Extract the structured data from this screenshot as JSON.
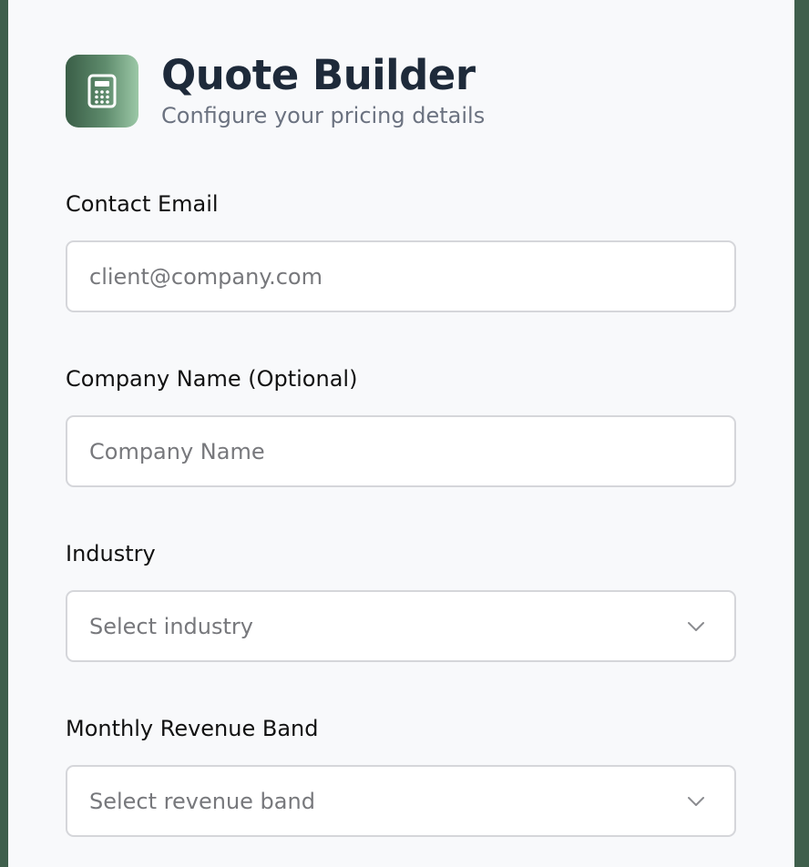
{
  "header": {
    "title": "Quote Builder",
    "subtitle": "Configure your pricing details",
    "logo_icon": "calculator-icon"
  },
  "form": {
    "contact_email": {
      "label": "Contact Email",
      "placeholder": "client@company.com",
      "value": ""
    },
    "company_name": {
      "label": "Company Name (Optional)",
      "placeholder": "Company Name",
      "value": ""
    },
    "industry": {
      "label": "Industry",
      "selected": "Select industry",
      "icon": "chevron-down-icon"
    },
    "revenue_band": {
      "label": "Monthly Revenue Band",
      "selected": "Select revenue band",
      "icon": "chevron-down-icon"
    }
  },
  "colors": {
    "background": "#3f5f4c",
    "panel": "#f8f9fb",
    "title": "#1e2a3a",
    "subtitle": "#6b7280",
    "input_border": "#d5d6da",
    "placeholder": "#77787c",
    "logo_gradient_start": "#3a5e47",
    "logo_gradient_end": "#9cc8a7"
  }
}
